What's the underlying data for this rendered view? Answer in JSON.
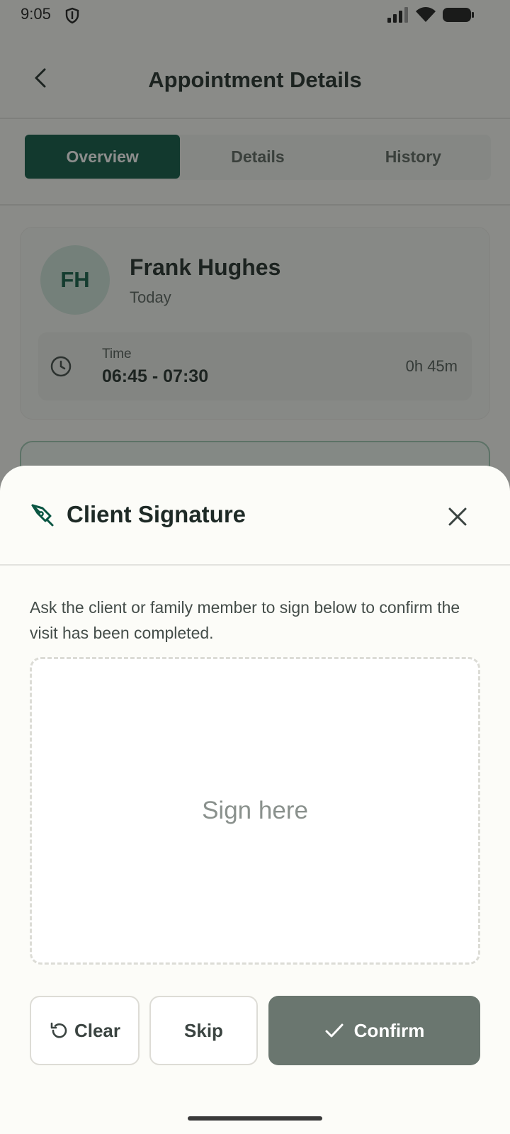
{
  "status_bar": {
    "time": "9:05"
  },
  "app_bar": {
    "title": "Appointment Details"
  },
  "tabs": [
    {
      "label": "Overview",
      "active": true
    },
    {
      "label": "Details",
      "active": false
    },
    {
      "label": "History",
      "active": false
    }
  ],
  "client": {
    "initials": "FH",
    "name": "Frank Hughes",
    "day": "Today",
    "time_label": "Time",
    "time_range": "06:45 - 07:30",
    "duration": "0h 45m"
  },
  "sheet": {
    "title": "Client Signature",
    "description": "Ask the client or family member to sign below to confirm the visit has been completed.",
    "placeholder": "Sign here",
    "clear_label": "Clear",
    "skip_label": "Skip",
    "confirm_label": "Confirm"
  },
  "colors": {
    "primary": "#0b5643",
    "avatar_bg": "#cfe5da",
    "confirm_disabled": "#6a766f",
    "scrim": "rgba(25,27,25,0.5)"
  },
  "icons": [
    "shield-icon",
    "signal-icon",
    "wifi-icon",
    "battery-icon",
    "back-arrow-icon",
    "clock-icon",
    "pen-icon",
    "close-icon",
    "undo-icon",
    "check-icon"
  ]
}
